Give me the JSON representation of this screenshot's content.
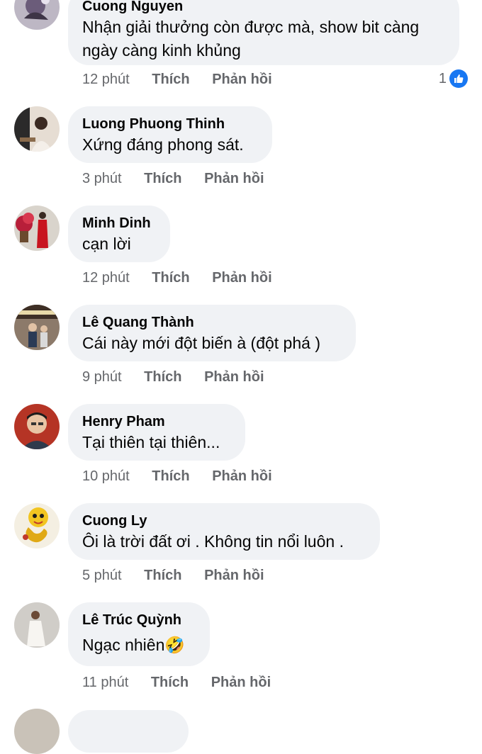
{
  "comments": [
    {
      "author": "Cuong Nguyen",
      "text": "Nhận giải thưởng còn được mà, show bit càng ngày càng kinh khủng",
      "time": "12 phút",
      "like_label": "Thích",
      "reply_label": "Phản hồi",
      "reaction_count": "1",
      "reaction_icon": "like-icon"
    },
    {
      "author": "Luong Phuong Thinh",
      "text": "Xứng đáng phong sát.",
      "time": "3 phút",
      "like_label": "Thích",
      "reply_label": "Phản hồi"
    },
    {
      "author": "Minh Dinh",
      "text": "cạn lời",
      "time": "12 phút",
      "like_label": "Thích",
      "reply_label": "Phản hồi"
    },
    {
      "author": "Lê Quang Thành",
      "text": "Cái này mới đột biến à (đột phá )",
      "time": "9 phút",
      "like_label": "Thích",
      "reply_label": "Phản hồi"
    },
    {
      "author": "Henry Pham",
      "text": "Tại thiên tại thiên...",
      "time": "10 phút",
      "like_label": "Thích",
      "reply_label": "Phản hồi"
    },
    {
      "author": "Cuong Ly",
      "text": "Ôi là trời đất ơi . Không tin nổi luôn .",
      "time": "5 phút",
      "like_label": "Thích",
      "reply_label": "Phản hồi"
    },
    {
      "author": "Lê Trúc Quỳnh",
      "text": "Ngạc nhiên🤣",
      "time": "11 phút",
      "like_label": "Thích",
      "reply_label": "Phản hồi"
    }
  ],
  "colors": {
    "bubble_bg": "#f0f2f5",
    "meta_text": "#65676b",
    "like_blue": "#1877f2"
  }
}
